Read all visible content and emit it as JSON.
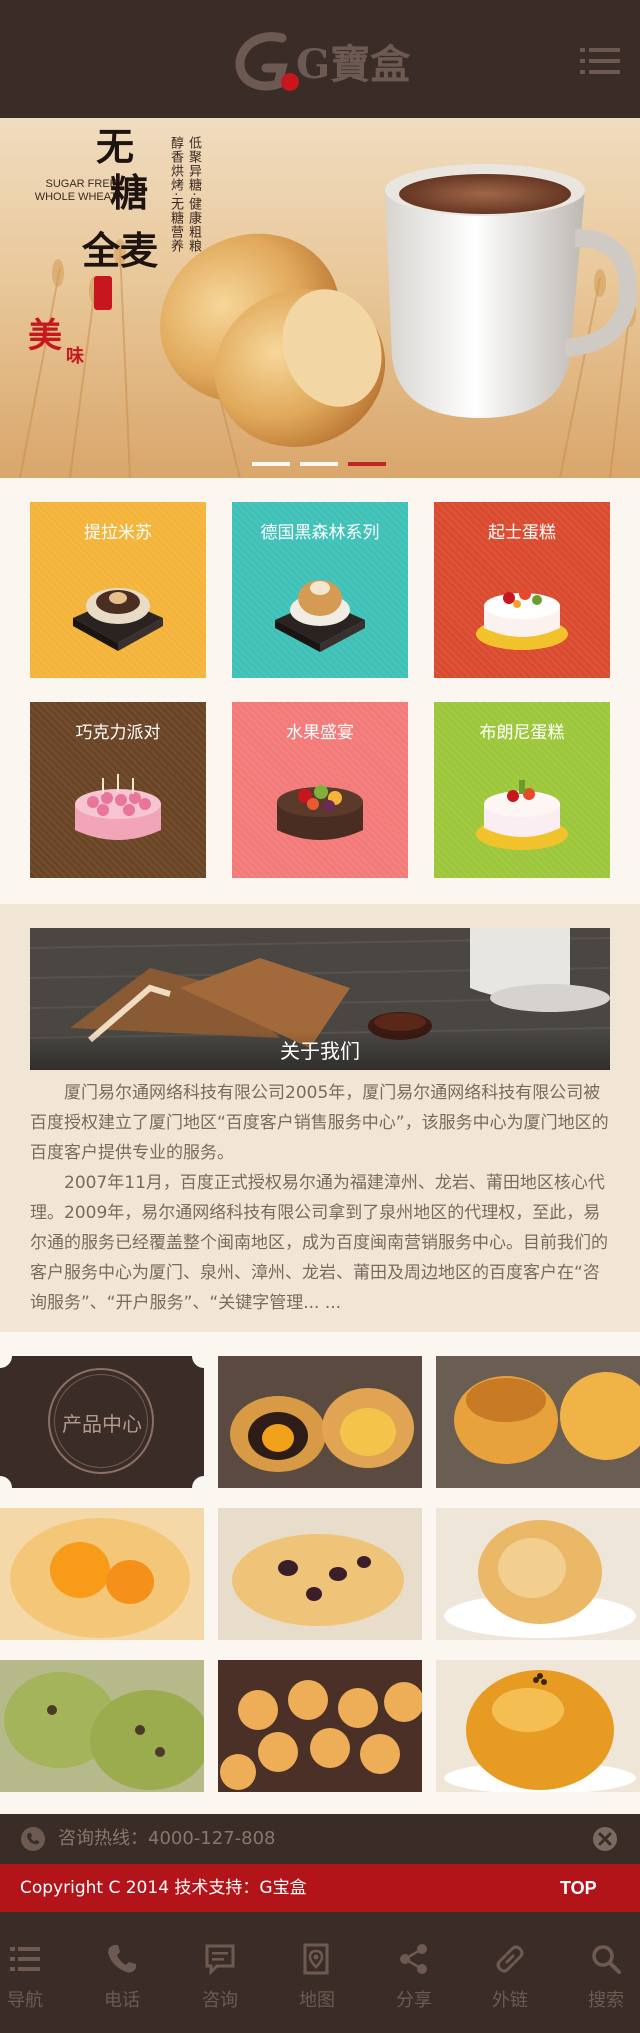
{
  "header": {
    "logo_text": "G寶盒",
    "menu_icon": "menu-icon"
  },
  "banner": {
    "english_line1": "SUGAR FREE",
    "english_line2": "WHOLE WHEAT",
    "title_chars": [
      "无",
      "糖",
      "全",
      "麦"
    ],
    "vertical_lines": [
      "低聚异糖·健康粗粮",
      "醇香烘烤·无糖营养"
    ],
    "mei": "美",
    "wei": "味",
    "slides_count": 3,
    "active_slide": 3
  },
  "categories": [
    {
      "label": "提拉米苏",
      "color": "#f4b43a"
    },
    {
      "label": "德国黑森林系列",
      "color": "#3fc1b7"
    },
    {
      "label": "起士蛋糕",
      "color": "#d94a2f"
    },
    {
      "label": "巧克力派对",
      "color": "#6a4424"
    },
    {
      "label": "水果盛宴",
      "color": "#f27a78"
    },
    {
      "label": "布朗尼蛋糕",
      "color": "#9dc73a"
    }
  ],
  "about": {
    "title": "关于我们",
    "paragraph1": "厦门易尔通网络科技有限公司2005年，厦门易尔通网络科技有限公司被百度授权建立了厦门地区“百度客户销售服务中心”，该服务中心为厦门地区的百度客户提供专业的服务。",
    "paragraph2": "2007年11月，百度正式授权易尔通为福建漳州、龙岩、莆田地区核心代理。2009年，易尔通网络科技有限公司拿到了泉州地区的代理权，至此，易尔通的服务已经覆盖整个闽南地区，成为百度闽南营销服务中心。目前我们的客户服务中心为厦门、泉州、漳州、龙岩、莆田及周边地区的百度客户在“咨询服务”、“开户服务”、“关键字管理... ..."
  },
  "products": {
    "center_label": "产品中心",
    "items": [
      {
        "name": "pastry-1"
      },
      {
        "name": "pastry-2"
      },
      {
        "name": "pastry-3"
      },
      {
        "name": "pastry-4"
      },
      {
        "name": "pastry-5"
      },
      {
        "name": "pastry-6"
      },
      {
        "name": "pastry-7"
      },
      {
        "name": "pastry-8"
      }
    ]
  },
  "hotline": {
    "text": "咨询热线：4000-127-808"
  },
  "footer": {
    "copyright": "Copyright C 2014 技术支持：G宝盒",
    "top_label": "TOP"
  },
  "bottom_nav": [
    {
      "label": "导航",
      "icon": "list-icon"
    },
    {
      "label": "电话",
      "icon": "phone-icon"
    },
    {
      "label": "咨询",
      "icon": "chat-icon"
    },
    {
      "label": "地图",
      "icon": "map-icon"
    },
    {
      "label": "分享",
      "icon": "share-icon"
    },
    {
      "label": "外链",
      "icon": "link-icon"
    },
    {
      "label": "搜索",
      "icon": "search-icon"
    }
  ]
}
